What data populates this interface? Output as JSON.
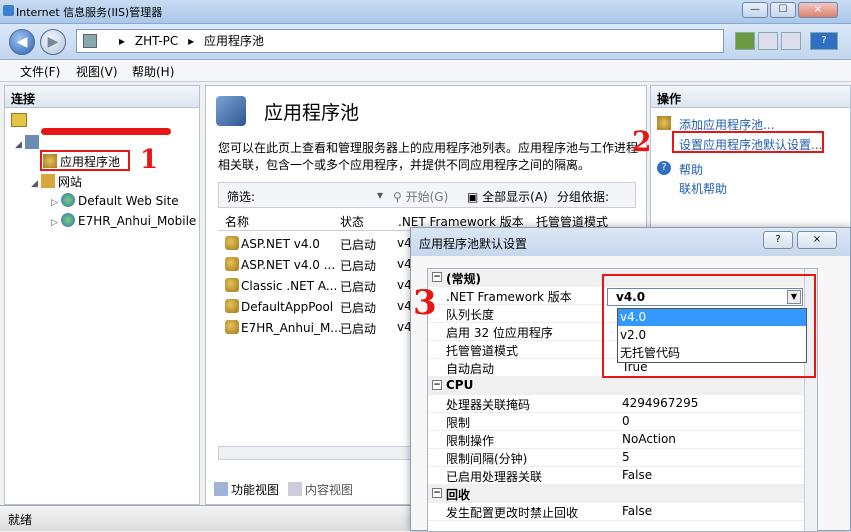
{
  "window": {
    "title": "Internet 信息服务(IIS)管理器",
    "controls": [
      "—",
      "☐",
      "⨯"
    ]
  },
  "address": {
    "crumbs": [
      "▸",
      "ZHT-PC",
      "▸",
      "应用程序池"
    ]
  },
  "menu": [
    "文件(F)",
    "视图(V)",
    "帮助(H)"
  ],
  "left_panel": {
    "header": "连接",
    "tree": [
      {
        "label": "应用程序池",
        "indent": 2
      },
      {
        "label": "网站",
        "indent": 1
      },
      {
        "label": "Default Web Site",
        "indent": 2
      },
      {
        "label": "E7HR_Anhui_Mobile",
        "indent": 2
      }
    ]
  },
  "center": {
    "title": "应用程序池",
    "description_lines": [
      "您可以在此页上查看和管理服务器上的应用程序池列表。应用程序池与工作进程",
      "相关联，包含一个或多个应用程序，并提供不同应用程序之间的隔离。"
    ],
    "filter": {
      "label": "筛选:",
      "start": "开始(G)",
      "show_all": "全部显示(A)",
      "group_by": "分组依据:"
    },
    "columns": [
      "名称",
      "状态",
      ".NET Framework 版本",
      "托管管道模式"
    ],
    "rows": [
      {
        "name": "ASP.NET v4.0",
        "status": "已启动",
        "ver": "v4"
      },
      {
        "name": "ASP.NET v4.0 ...",
        "status": "已启动",
        "ver": "v4"
      },
      {
        "name": "Classic .NET A...",
        "status": "已启动",
        "ver": "v4"
      },
      {
        "name": "DefaultAppPool",
        "status": "已启动",
        "ver": "v4"
      },
      {
        "name": "E7HR_Anhui_M...",
        "status": "已启动",
        "ver": "v4"
      }
    ],
    "views": {
      "features": "功能视图",
      "content": "内容视图"
    }
  },
  "right_panel": {
    "header": "操作",
    "actions": [
      "添加应用程序池...",
      "设置应用程序池默认设置...",
      "帮助",
      "联机帮助"
    ]
  },
  "status": "就绪",
  "dialog": {
    "title": "应用程序池默认设置",
    "buttons": [
      "?",
      "⨯"
    ],
    "groups": [
      {
        "name": "(常规)",
        "items": [
          {
            "key": ".NET Framework 版本",
            "value": "v4.0"
          },
          {
            "key": "队列长度",
            "value": ""
          },
          {
            "key": "启用 32 位应用程序",
            "value": ""
          },
          {
            "key": "托管管道模式",
            "value": ""
          },
          {
            "key": "自动启动",
            "value": "True"
          }
        ]
      },
      {
        "name": "CPU",
        "items": [
          {
            "key": "处理器关联掩码",
            "value": "4294967295"
          },
          {
            "key": "限制",
            "value": "0"
          },
          {
            "key": "限制操作",
            "value": "NoAction"
          },
          {
            "key": "限制间隔(分钟)",
            "value": "5"
          },
          {
            "key": "已启用处理器关联",
            "value": "False"
          }
        ]
      },
      {
        "name": "回收",
        "items": [
          {
            "key": "发生配置更改时禁止回收",
            "value": "False"
          }
        ]
      }
    ],
    "dropdown": {
      "selected": "v4.0",
      "options": [
        "v4.0",
        "v2.0",
        "无托管代码"
      ]
    }
  },
  "annotations": {
    "one": "1",
    "two": "2",
    "three": "3"
  }
}
